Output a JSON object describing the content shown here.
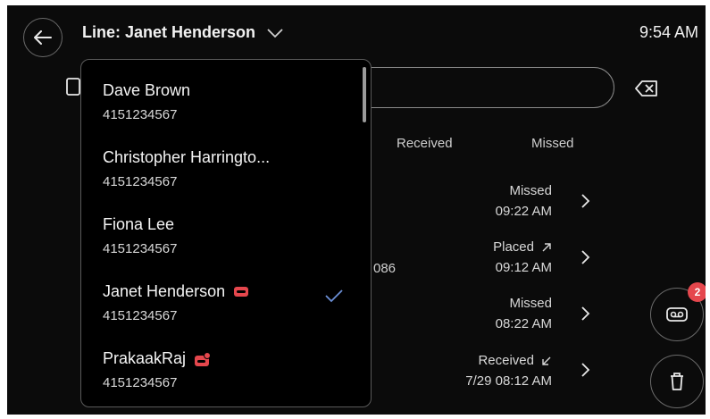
{
  "header": {
    "line_title": "Line: Janet Henderson",
    "time": "9:54 AM"
  },
  "tabs": {
    "received": "Received",
    "missed": "Missed"
  },
  "partial_number": "086",
  "calls": [
    {
      "status": "Missed",
      "time": "09:22 AM",
      "icon": "none"
    },
    {
      "status": "Placed",
      "time": "09:12 AM",
      "icon": "arrow-up-right-icon"
    },
    {
      "status": "Missed",
      "time": "08:22 AM",
      "icon": "none"
    },
    {
      "status": "Received",
      "time": "7/29 08:12 AM",
      "icon": "arrow-down-left-icon"
    }
  ],
  "voicemail_badge": "2",
  "dropdown": {
    "items": [
      {
        "name": "Dave Brown",
        "number": "4151234567"
      },
      {
        "name": "Christopher Harringto...",
        "number": "4151234567"
      },
      {
        "name": "Fiona Lee",
        "number": "4151234567"
      },
      {
        "name": "Janet Henderson",
        "number": "4151234567",
        "selected": true
      },
      {
        "name": "PrakaakRaj",
        "number": "4151234567"
      }
    ]
  },
  "colors": {
    "background": "#0b0b0b",
    "accent_check": "#6b8fd6",
    "voicemail_red": "#e5474d"
  }
}
